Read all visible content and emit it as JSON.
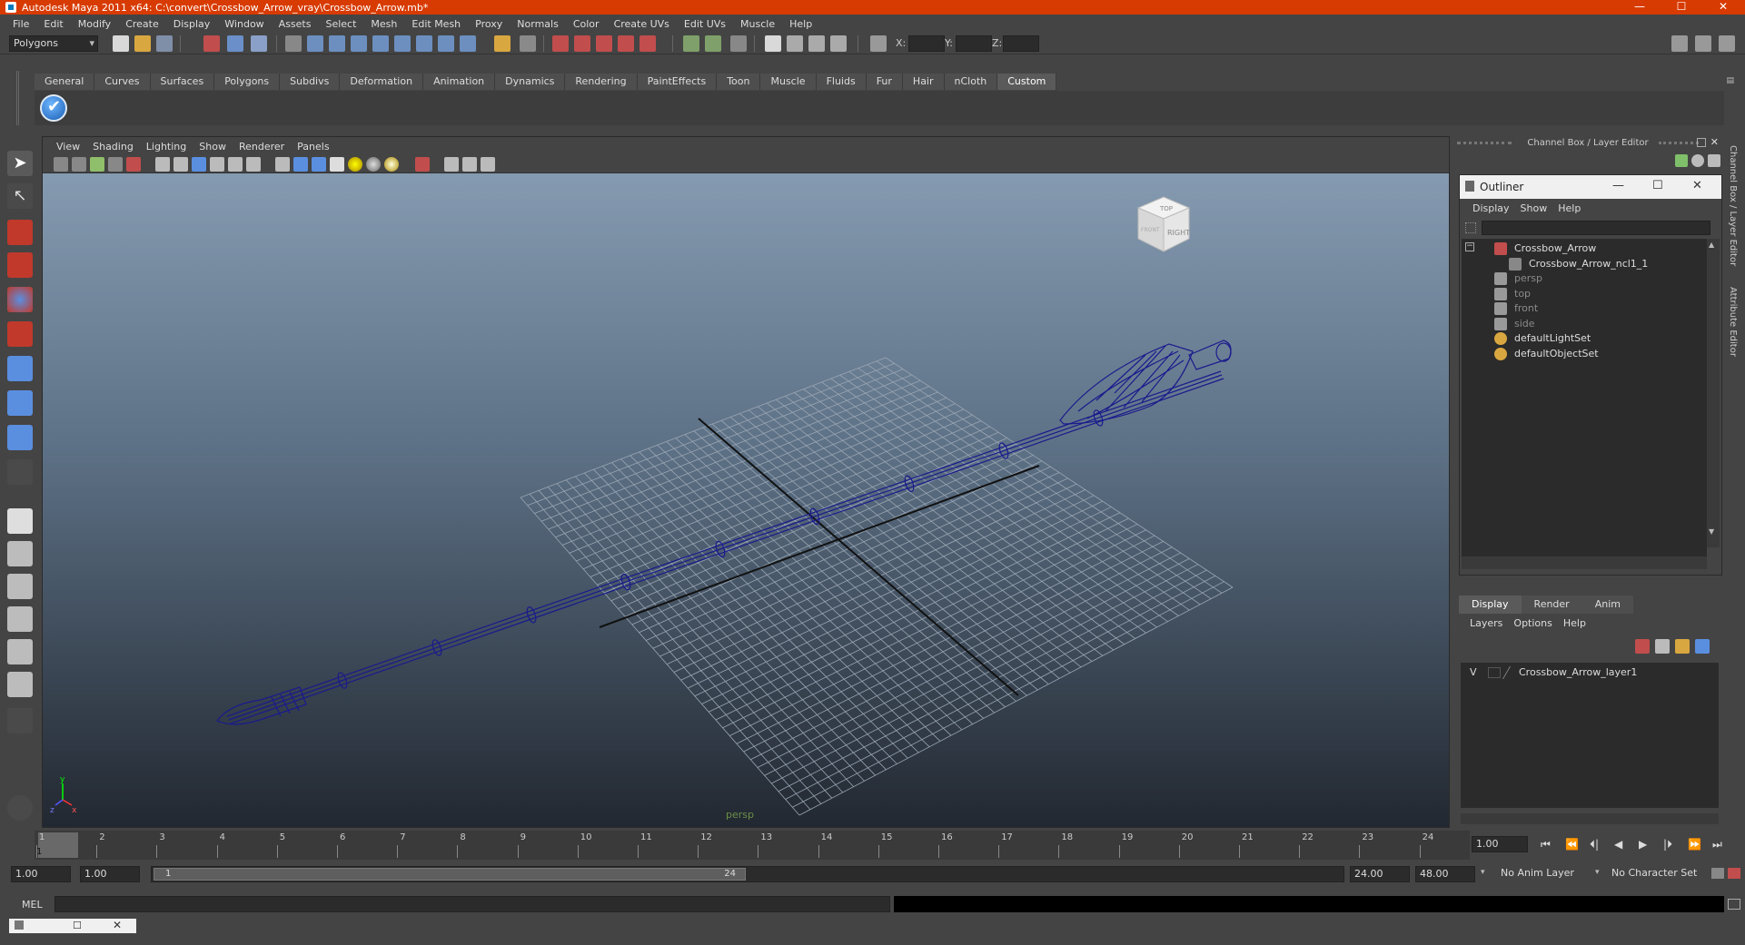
{
  "window": {
    "title": "Autodesk Maya 2011 x64: C:\\convert\\Crossbow_Arrow_vray\\Crossbow_Arrow.mb*",
    "minimize": "—",
    "maximize": "☐",
    "close": "✕"
  },
  "menubar": [
    "File",
    "Edit",
    "Modify",
    "Create",
    "Display",
    "Window",
    "Assets",
    "Select",
    "Mesh",
    "Edit Mesh",
    "Proxy",
    "Normals",
    "Color",
    "Create UVs",
    "Edit UVs",
    "Muscle",
    "Help"
  ],
  "statusline": {
    "mode": "Polygons",
    "x_label": "X:",
    "y_label": "Y:",
    "z_label": "Z:"
  },
  "shelf": {
    "tabs": [
      "General",
      "Curves",
      "Surfaces",
      "Polygons",
      "Subdivs",
      "Deformation",
      "Animation",
      "Dynamics",
      "Rendering",
      "PaintEffects",
      "Toon",
      "Muscle",
      "Fluids",
      "Fur",
      "Hair",
      "nCloth",
      "Custom"
    ],
    "active": "Custom"
  },
  "viewport": {
    "menu": [
      "View",
      "Shading",
      "Lighting",
      "Show",
      "Renderer",
      "Panels"
    ],
    "camera_label": "persp",
    "viewcube_faces": {
      "top": "TOP",
      "right": "RIGHT",
      "front": "FRONT"
    },
    "axis": {
      "x": "x",
      "y": "y",
      "z": "z"
    },
    "colors": {
      "wire": "#1a1a8c",
      "grid": "#9aa6b3",
      "axis": "#111111"
    }
  },
  "channel_box": {
    "title": "Channel Box / Layer Editor"
  },
  "outliner": {
    "title": "Outliner",
    "menu": [
      "Display",
      "Show",
      "Help"
    ],
    "nodes": [
      {
        "label": "Crossbow_Arrow",
        "dim": false
      },
      {
        "label": "Crossbow_Arrow_ncl1_1",
        "dim": false
      },
      {
        "label": "persp",
        "dim": true
      },
      {
        "label": "top",
        "dim": true
      },
      {
        "label": "front",
        "dim": true
      },
      {
        "label": "side",
        "dim": true
      },
      {
        "label": "defaultLightSet",
        "dim": false
      },
      {
        "label": "defaultObjectSet",
        "dim": false
      }
    ]
  },
  "layer_editor": {
    "tabs": [
      "Display",
      "Render",
      "Anim"
    ],
    "active": "Display",
    "menu": [
      "Layers",
      "Options",
      "Help"
    ],
    "layers": [
      {
        "visible": "V",
        "name": "Crossbow_Arrow_layer1"
      }
    ]
  },
  "side_tabs": [
    "Channel Box / Layer Editor",
    "Attribute Editor"
  ],
  "timeline": {
    "ticks": [
      "1",
      "2",
      "3",
      "4",
      "5",
      "6",
      "7",
      "8",
      "9",
      "10",
      "11",
      "12",
      "13",
      "14",
      "15",
      "16",
      "17",
      "18",
      "19",
      "20",
      "21",
      "22",
      "23",
      "24"
    ],
    "current_frame_label": "1",
    "current_frame": "1.00",
    "playback": [
      "⏮",
      "⏪",
      "⏴|",
      "◀",
      "▶",
      "|⏵",
      "⏩",
      "⏭"
    ]
  },
  "range": {
    "start": "1.00",
    "playback_start": "1.00",
    "slider_start": "1",
    "slider_end": "24",
    "playback_end": "24.00",
    "end": "48.00",
    "anim_layer": "No Anim Layer",
    "character_set": "No Character Set"
  },
  "command_line": {
    "label": "MEL"
  }
}
